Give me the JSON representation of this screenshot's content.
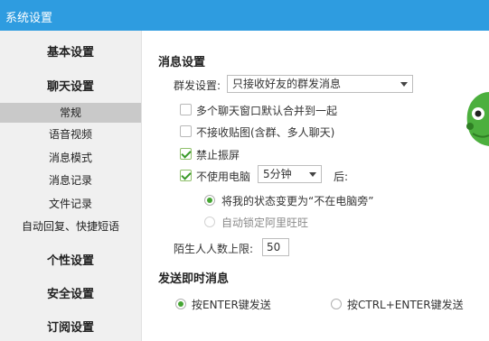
{
  "window": {
    "title": "系统设置"
  },
  "sidebar": {
    "sections": {
      "basic": "基本设置",
      "chat": "聊天设置",
      "personal": "个性设置",
      "security": "安全设置",
      "subscribe": "订阅设置"
    },
    "chat_items": [
      "常规",
      "语音视频",
      "消息模式",
      "消息记录",
      "文件记录",
      "自动回复、快捷短语"
    ],
    "active_item": "常规"
  },
  "message_settings": {
    "header": "消息设置",
    "group_send_label": "群发设置:",
    "group_send_value": "只接收好友的群发消息",
    "merge_windows_label": "多个聊天窗口默认合并到一起",
    "merge_windows_checked": false,
    "no_stickers_label": "不接收贴图(含群、多人聊天)",
    "no_stickers_checked": false,
    "disable_shake_label": "禁止振屏",
    "disable_shake_checked": true,
    "idle_label": "不使用电脑",
    "idle_checked": true,
    "idle_time_value": "5分钟",
    "idle_after_label": "后:",
    "idle_option_status": "将我的状态变更为“不在电脑旁”",
    "idle_option_lock": "自动锁定阿里旺旺",
    "idle_selected": "status",
    "stranger_limit_label": "陌生人人数上限:",
    "stranger_limit_value": "50"
  },
  "send_settings": {
    "header": "发送即时消息",
    "enter_label": "按ENTER键发送",
    "ctrl_enter_label": "按CTRL+ENTER键发送",
    "selected": "enter"
  },
  "colors": {
    "title_bar": "#2e9ce0",
    "check_green": "#3a9a2a",
    "radio_green": "#45a533",
    "mascot_green": "#4caf3e"
  }
}
